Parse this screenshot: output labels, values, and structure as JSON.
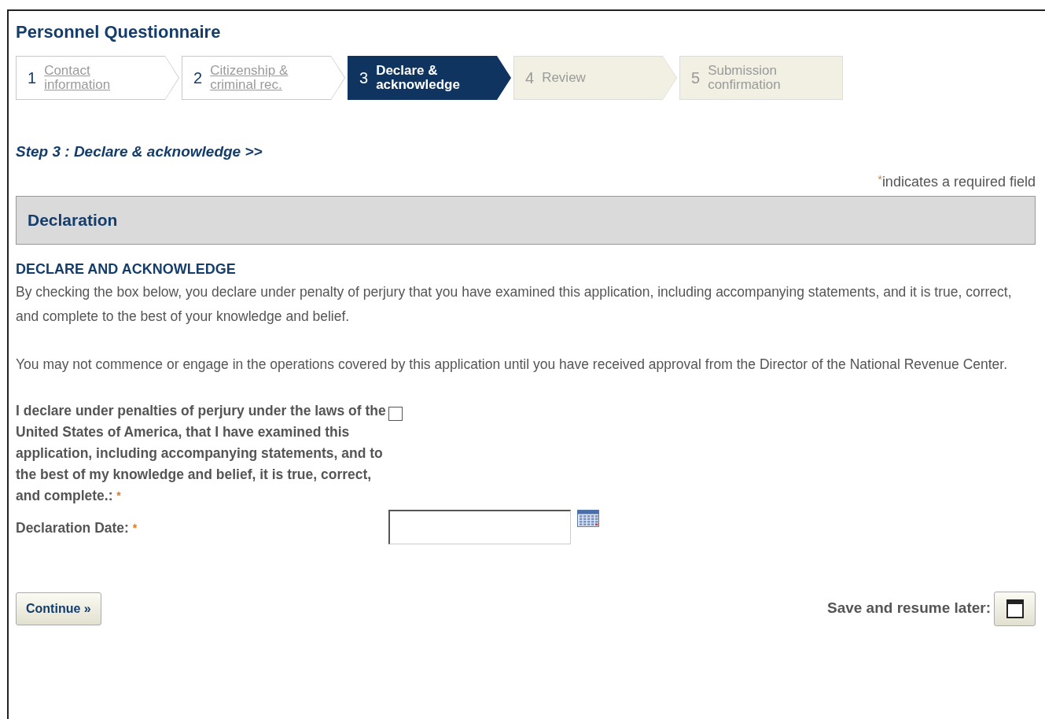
{
  "title": "Personnel Questionnaire",
  "steps": [
    {
      "number": "1",
      "label_lines": [
        "Contact",
        "information"
      ],
      "kind": "link",
      "selected": false
    },
    {
      "number": "2",
      "label_lines": [
        "Citizenship &",
        "criminal rec."
      ],
      "kind": "link",
      "selected": false
    },
    {
      "number": "3",
      "label_lines": [
        "Declare &",
        "acknowledge"
      ],
      "kind": "link",
      "selected": true
    },
    {
      "number": "4",
      "label_lines": [
        "Review"
      ],
      "kind": "locked",
      "selected": false
    },
    {
      "number": "5",
      "label_lines": [
        "Submission",
        "confirmation"
      ],
      "kind": "locked",
      "selected": false
    }
  ],
  "step_heading": "Step 3 : Declare & acknowledge >>",
  "required_note": {
    "mark": "*",
    "text": "indicates a required field"
  },
  "section_title": "Declaration",
  "subheading": "DECLARE AND ACKNOWLEDGE",
  "paragraphs": [
    "By checking the box below, you declare under penalty of perjury that you have examined this application, including accompanying statements, and it is true, correct, and complete to the best of your knowledge and belief.",
    "You may not commence or engage in the operations covered by this application until you have received approval from the Director of the National Revenue Center."
  ],
  "fields": [
    {
      "kind": "checkbox",
      "label": "I declare under penalties of perjury under the laws of the United States of America, that I have examined this application, including accompanying statements, and to the best of my knowledge and belief, it is true, correct, and complete.:",
      "required_mark": "*",
      "checked": false
    },
    {
      "kind": "date",
      "label": "Declaration Date:",
      "required_mark": "*"
    }
  ],
  "continue_button": "Continue »",
  "save_label": "Save and resume later:"
}
